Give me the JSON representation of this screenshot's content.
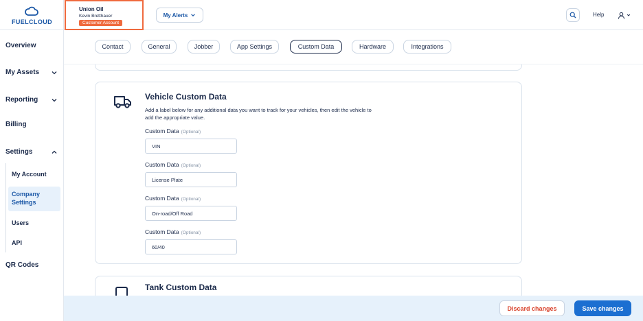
{
  "brand": {
    "name": "FUELCLOUD",
    "color": "#1a57a6",
    "icon": "cloud-icon"
  },
  "account": {
    "company": "Union Oil",
    "user": "Kevin Bretthauer",
    "badge": "Customer Account",
    "highlight_color": "#ef6a3e"
  },
  "header": {
    "alerts_label": "My Alerts",
    "help_label": "Help",
    "search_icon": "search-icon",
    "user_icon": "user-icon"
  },
  "sidebar": {
    "items": [
      {
        "label": "Overview"
      },
      {
        "label": "My Assets"
      },
      {
        "label": "Reporting"
      },
      {
        "label": "Billing"
      },
      {
        "label": "Settings"
      }
    ],
    "settings_sub": [
      {
        "label": "My Account"
      },
      {
        "label": "Company Settings",
        "active": true
      },
      {
        "label": "Users"
      },
      {
        "label": "API"
      }
    ],
    "qr_label": "QR Codes"
  },
  "tabs": [
    {
      "label": "Contact"
    },
    {
      "label": "General"
    },
    {
      "label": "Jobber"
    },
    {
      "label": "App Settings"
    },
    {
      "label": "Custom Data",
      "active": true
    },
    {
      "label": "Hardware"
    },
    {
      "label": "Integrations"
    }
  ],
  "vehicle_card": {
    "icon": "truck-icon",
    "title": "Vehicle Custom Data",
    "description": "Add a label below for any additional data you want to track for your vehicles, then edit the vehicle to add the appropriate value.",
    "fields": [
      {
        "label": "Custom Data",
        "optional": "(Optional)",
        "value": "VIN"
      },
      {
        "label": "Custom Data",
        "optional": "(Optional)",
        "value": "License Plate"
      },
      {
        "label": "Custom Data",
        "optional": "(Optional)",
        "value": "On-road/Off Road"
      },
      {
        "label": "Custom Data",
        "optional": "(Optional)",
        "value": "60/40"
      }
    ]
  },
  "tank_card": {
    "icon": "tank-icon",
    "title": "Tank Custom Data"
  },
  "footer": {
    "discard_label": "Discard changes",
    "save_label": "Save changes",
    "primary_color": "#1c6fd1",
    "danger_color": "#d9422b"
  }
}
